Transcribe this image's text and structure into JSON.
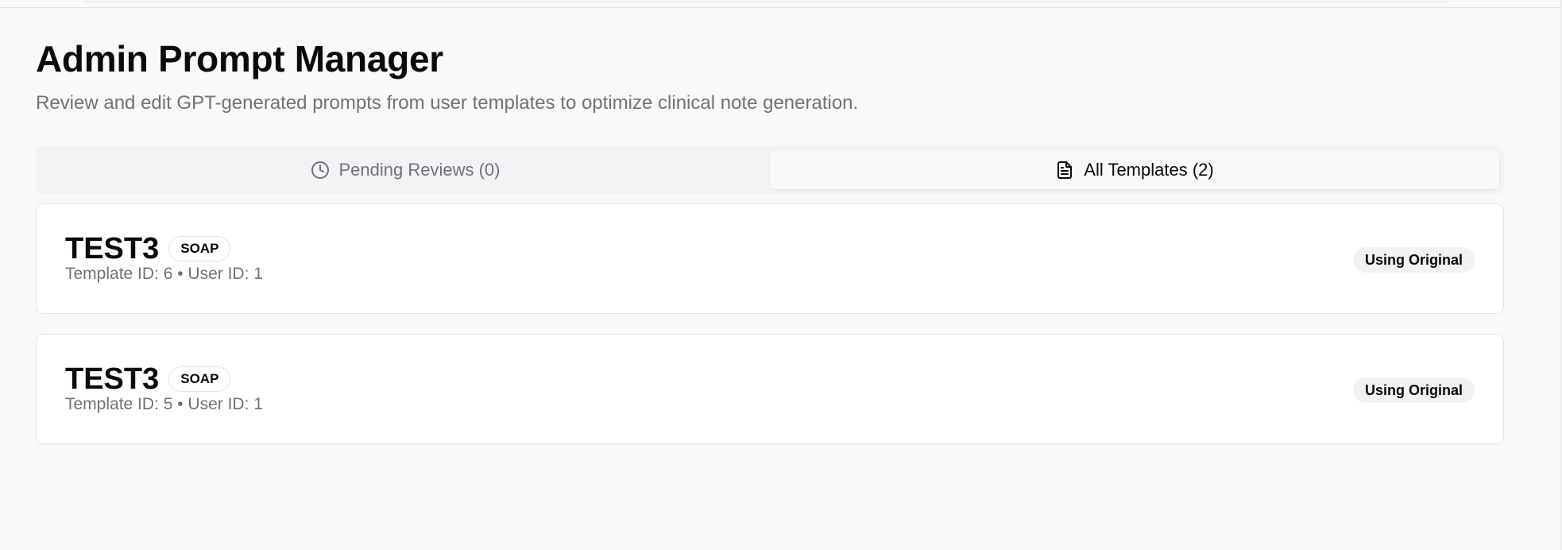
{
  "header": {
    "title": "Admin Prompt Manager",
    "subtitle": "Review and edit GPT-generated prompts from user templates to optimize clinical note generation."
  },
  "tabs": [
    {
      "label": "Pending Reviews (0)",
      "icon": "clock-icon",
      "active": false
    },
    {
      "label": "All Templates (2)",
      "icon": "file-text-icon",
      "active": true
    }
  ],
  "templates": [
    {
      "name": "TEST3",
      "type": "SOAP",
      "meta": "Template ID: 6 • User ID: 1",
      "status": "Using Original"
    },
    {
      "name": "TEST3",
      "type": "SOAP",
      "meta": "Template ID: 5 • User ID: 1",
      "status": "Using Original"
    }
  ],
  "colors": {
    "background": "#f9f9f9",
    "muted_text": "#71717a",
    "border": "#e4e4e7",
    "tab_bg": "#f2f3f5"
  }
}
